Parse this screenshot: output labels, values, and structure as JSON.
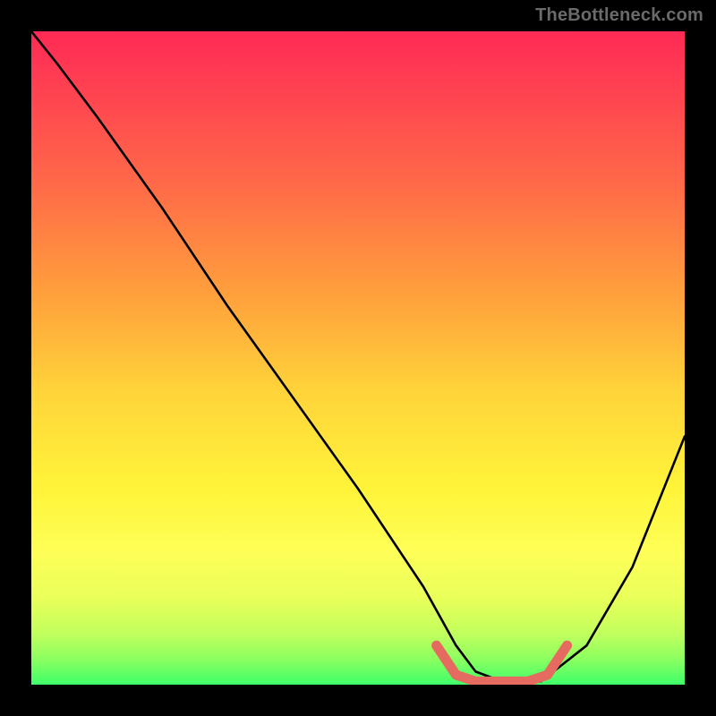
{
  "watermark": "TheBottleneck.com",
  "chart_data": {
    "type": "line",
    "title": "",
    "xlabel": "",
    "ylabel": "",
    "xlim": [
      0,
      100
    ],
    "ylim": [
      0,
      100
    ],
    "series": [
      {
        "name": "main-curve",
        "color": "#000000",
        "x": [
          0,
          4,
          10,
          20,
          30,
          40,
          50,
          60,
          65,
          68,
          72,
          78,
          85,
          92,
          100
        ],
        "y": [
          100,
          95,
          87,
          73,
          58,
          44,
          30,
          15,
          6,
          2,
          0.5,
          0.5,
          6,
          18,
          38
        ]
      },
      {
        "name": "trough-highlight",
        "color": "#e56a5f",
        "x": [
          62,
          65,
          68,
          72,
          76,
          79,
          82
        ],
        "y": [
          6,
          1.5,
          0.5,
          0.5,
          0.5,
          1.5,
          6
        ]
      }
    ],
    "gradient_stops": [
      {
        "pos": 0,
        "color": "#ff2a55"
      },
      {
        "pos": 25,
        "color": "#ff6e47"
      },
      {
        "pos": 55,
        "color": "#ffd33a"
      },
      {
        "pos": 80,
        "color": "#feff58"
      },
      {
        "pos": 96,
        "color": "#8dff60"
      },
      {
        "pos": 100,
        "color": "#3fff6a"
      }
    ]
  }
}
